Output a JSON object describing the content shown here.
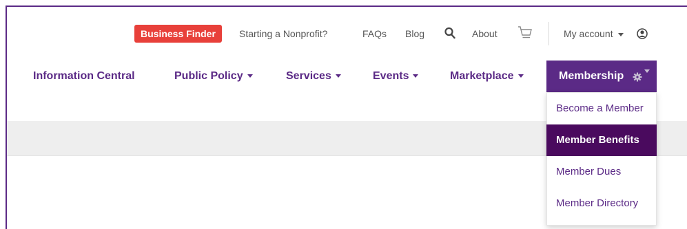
{
  "topbar": {
    "business_finder": "Business Finder",
    "links": [
      "Starting a Nonprofit?",
      "FAQs",
      "Blog",
      "About"
    ],
    "my_account": "My account"
  },
  "nav": {
    "items": [
      {
        "label": "Information Central",
        "has_caret": false
      },
      {
        "label": "Public Policy",
        "has_caret": true
      },
      {
        "label": "Services",
        "has_caret": true
      },
      {
        "label": "Events",
        "has_caret": true
      },
      {
        "label": "Marketplace",
        "has_caret": true
      },
      {
        "label": "Membership",
        "has_caret": true,
        "active": true
      }
    ]
  },
  "dropdown": {
    "items": [
      {
        "label": "Become a Member"
      },
      {
        "label": "Member Benefits",
        "selected": true
      },
      {
        "label": "Member Dues"
      },
      {
        "label": "Member Directory"
      }
    ]
  },
  "colors": {
    "brand_purple": "#5b2a86",
    "selected_purple": "#4a0a5e",
    "badge_red": "#e8403a"
  },
  "icons": {
    "search": "search-icon",
    "cart": "cart-icon",
    "account": "user-circle-icon",
    "gear": "gear-icon"
  }
}
